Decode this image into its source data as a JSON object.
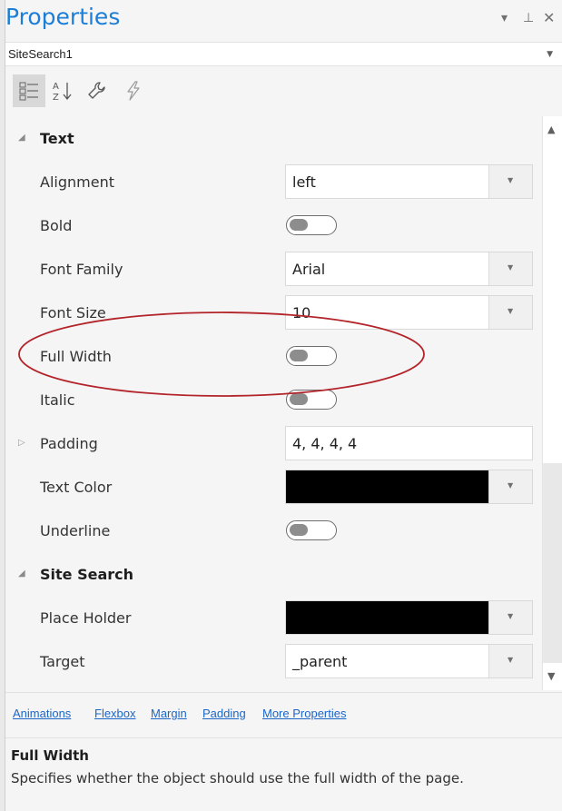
{
  "panel": {
    "title": "Properties",
    "controls": {
      "dropdown_glyph": "▾",
      "pin_glyph": "⊥",
      "close_glyph": "✕"
    }
  },
  "object_selector": {
    "value": "SiteSearch1"
  },
  "toolbar": {
    "items": [
      {
        "name": "categorized-view",
        "icon": "categorized-icon",
        "active": true
      },
      {
        "name": "alphabetical-view",
        "icon": "sort-az-icon",
        "active": false
      },
      {
        "name": "properties-view",
        "icon": "wrench-icon",
        "active": false
      },
      {
        "name": "events-view",
        "icon": "lightning-icon",
        "active": false
      }
    ]
  },
  "grid": {
    "categories": [
      {
        "label": "Text",
        "expanded": true
      },
      {
        "label": "Site Search",
        "expanded": true
      }
    ],
    "properties": {
      "alignment": {
        "label": "Alignment",
        "value": "left"
      },
      "bold": {
        "label": "Bold",
        "value": false
      },
      "font_family": {
        "label": "Font Family",
        "value": "Arial"
      },
      "font_size": {
        "label": "Font Size",
        "value": "10"
      },
      "full_width": {
        "label": "Full Width",
        "value": false
      },
      "italic": {
        "label": "Italic",
        "value": false
      },
      "padding": {
        "label": "Padding",
        "value": "4, 4, 4, 4"
      },
      "text_color": {
        "label": "Text Color",
        "color": "#000000"
      },
      "underline": {
        "label": "Underline",
        "value": false
      },
      "place_holder": {
        "label": "Place Holder",
        "color": "#000000"
      },
      "target": {
        "label": "Target",
        "value": "_parent"
      }
    }
  },
  "links": [
    "Animations",
    "Flexbox",
    "Margin",
    "Padding",
    "More Properties"
  ],
  "description": {
    "title": "Full Width",
    "text": "Specifies whether the object should use the full width of the page."
  },
  "colors": {
    "title_blue": "#1c7ed6",
    "link_blue": "#1c66c8",
    "annotation_red": "#b3242a",
    "panel_bg": "#f5f5f5"
  }
}
